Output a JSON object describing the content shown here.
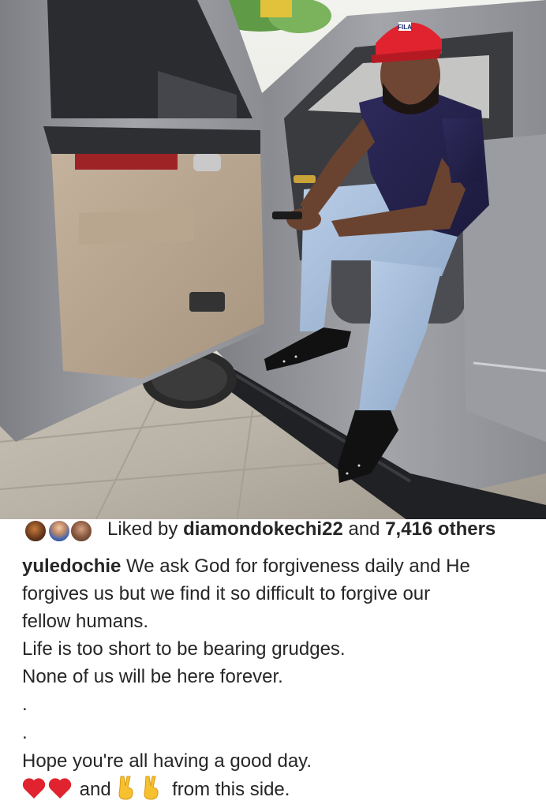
{
  "post": {
    "image_alt": "",
    "likes": {
      "prefix": "Liked by",
      "user": "diamondokechi22",
      "connector": "and",
      "others": "7,416 others"
    },
    "caption": {
      "username": "yuledochie",
      "line1_rest": "We ask God for forgiveness daily and He",
      "line2": "forgives us but we find it so difficult to forgive our",
      "line3": "fellow humans.",
      "line4": "Life is too short to be bearing grudges.",
      "line5": "None of us will be here forever.",
      "dot1": ".",
      "dot2": ".",
      "line6": "Hope you're all having a good day.",
      "line7_mid": "and",
      "line7_end": "from this side."
    },
    "cap_brand_text": "FILA"
  },
  "colors": {
    "text": "#262626",
    "heart": "#e0232e",
    "peace": "#f6c02f"
  },
  "icons": {
    "heart": "red-heart-emoji",
    "peace": "victory-hand-emoji"
  }
}
